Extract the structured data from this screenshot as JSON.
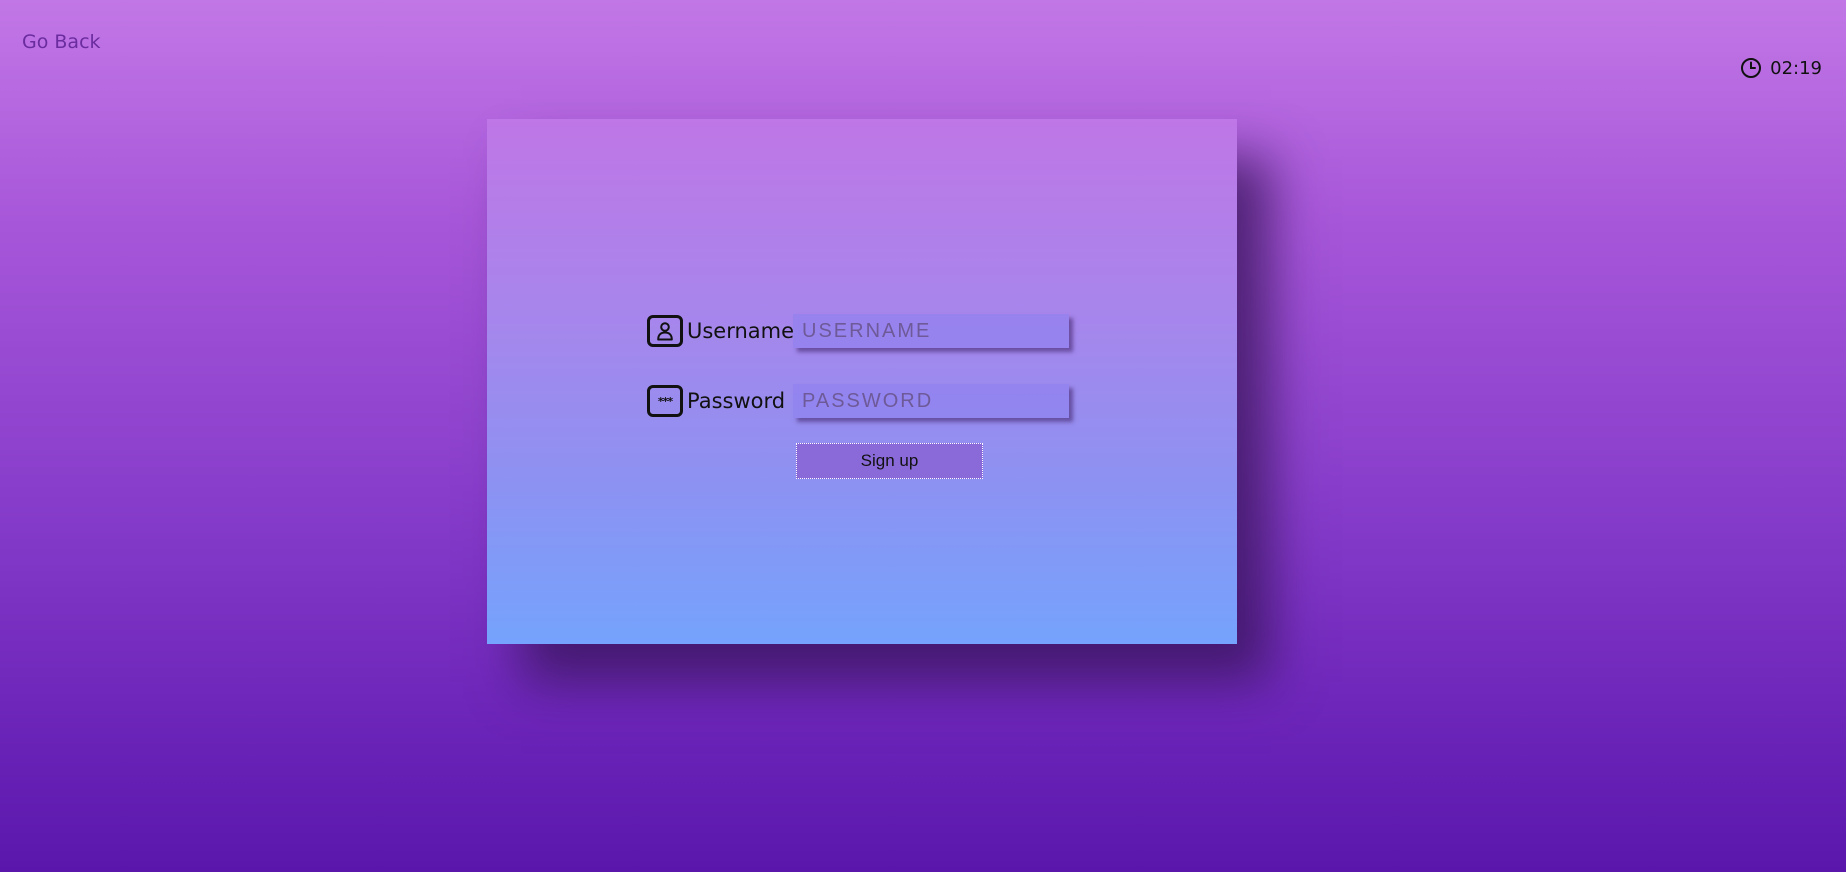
{
  "nav": {
    "go_back_label": "Go Back"
  },
  "timer": {
    "icon": "clock-icon",
    "value": "02:19"
  },
  "form": {
    "username": {
      "icon": "user-icon",
      "label": "Username",
      "placeholder": "USERNAME",
      "value": ""
    },
    "password": {
      "icon": "password-icon",
      "icon_glyph": "***",
      "label": "Password",
      "placeholder": "PASSWORD",
      "value": ""
    },
    "submit_label": "Sign up"
  },
  "colors": {
    "background_top": "#c277e6",
    "background_bottom": "#5a16ab",
    "card_top": "#bf76e6",
    "card_bottom": "#75a3fd",
    "button": "#8a6ad9",
    "link": "#6a2c9e"
  }
}
